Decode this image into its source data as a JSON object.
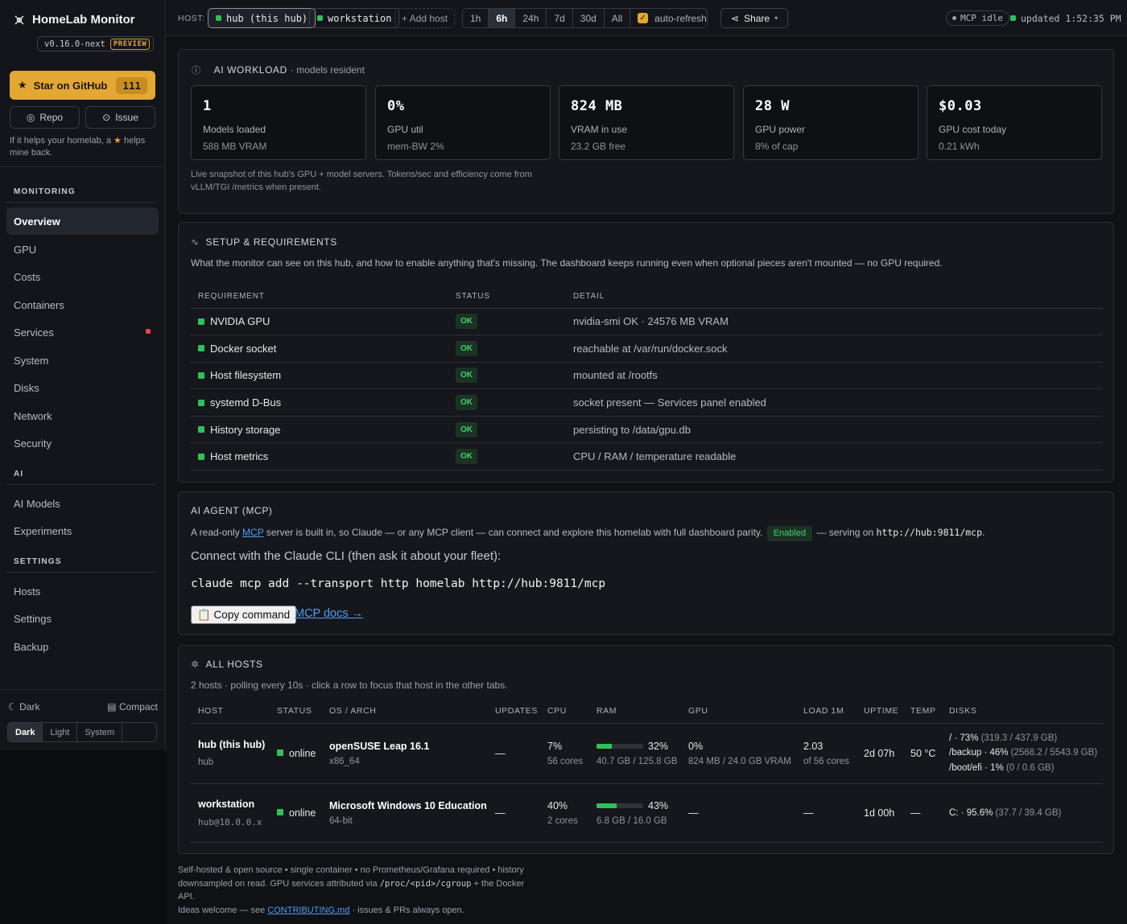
{
  "sidebar": {
    "app_title": "HomeLab Monitor",
    "version": "v0.16.0-next",
    "preview_badge": "PREVIEW",
    "star_label": "Star on GitHub",
    "star_count": "111",
    "repo_label": "Repo",
    "issue_label": "Issue",
    "help_text_1": "If it helps your homelab, a",
    "help_text_2": "helps mine back.",
    "sections": {
      "monitoring": "MONITORING",
      "ai": "AI",
      "settings": "SETTINGS"
    },
    "items": {
      "overview": "Overview",
      "gpu": "GPU",
      "costs": "Costs",
      "containers": "Containers",
      "services": "Services",
      "system": "System",
      "disks": "Disks",
      "network": "Network",
      "security": "Security",
      "ai_models": "AI Models",
      "experiments": "Experiments",
      "hosts": "Hosts",
      "settings": "Settings",
      "backup": "Backup"
    },
    "theme_label": "Dark",
    "compact_label": "Compact",
    "theme_options": [
      "Dark",
      "Light",
      "System"
    ]
  },
  "topbar": {
    "host_label": "HOST:",
    "hosts": [
      "hub (this hub)",
      "workstation"
    ],
    "add_host": "+ Add host",
    "ranges": [
      "1h",
      "6h",
      "24h",
      "7d",
      "30d",
      "All"
    ],
    "selected_range": "6h",
    "auto_refresh": "auto-refresh",
    "share": "Share",
    "mcp_status": "MCP idle",
    "updated": "updated 1:52:35 PM"
  },
  "ai_workload": {
    "title": "AI WORKLOAD",
    "subtitle": "· models resident",
    "stats": [
      {
        "value": "1",
        "label": "Models loaded",
        "sub": "588 MB VRAM"
      },
      {
        "value": "0%",
        "label": "GPU util",
        "sub": "mem-BW 2%"
      },
      {
        "value": "824 MB",
        "label": "VRAM in use",
        "sub": "23.2 GB free"
      },
      {
        "value": "28 W",
        "label": "GPU power",
        "sub": "8% of cap"
      },
      {
        "value": "$0.03",
        "label": "GPU cost today",
        "sub": "0.21 kWh"
      }
    ],
    "note": "Live snapshot of this hub's GPU + model servers. Tokens/sec and efficiency come from vLLM/TGI /metrics when present."
  },
  "setup": {
    "title": "SETUP & REQUIREMENTS",
    "description": "What the monitor can see on this hub, and how to enable anything that's missing. The dashboard keeps running even when optional pieces aren't mounted — no GPU required.",
    "columns": [
      "REQUIREMENT",
      "STATUS",
      "DETAIL"
    ],
    "rows": [
      {
        "name": "NVIDIA GPU",
        "status": "OK",
        "detail": "nvidia-smi OK · 24576 MB VRAM"
      },
      {
        "name": "Docker socket",
        "status": "OK",
        "detail": "reachable at /var/run/docker.sock"
      },
      {
        "name": "Host filesystem",
        "status": "OK",
        "detail": "mounted at /rootfs"
      },
      {
        "name": "systemd D-Bus",
        "status": "OK",
        "detail": "socket present — Services panel enabled"
      },
      {
        "name": "History storage",
        "status": "OK",
        "detail": "persisting to /data/gpu.db"
      },
      {
        "name": "Host metrics",
        "status": "OK",
        "detail": "CPU / RAM / temperature readable"
      }
    ]
  },
  "mcp": {
    "title": "AI AGENT (MCP)",
    "desc_1": "A read-only",
    "desc_link": "MCP",
    "desc_2": "server is built in, so Claude — or any MCP client — can connect and explore this homelab with full dashboard parity.",
    "enabled_badge": "Enabled",
    "desc_3": "— serving on",
    "endpoint": "http://hub:9811/mcp",
    "desc_4": ".",
    "connect_text": "Connect with the Claude CLI (then ask it about your fleet):",
    "command": "claude mcp add --transport http homelab http://hub:9811/mcp",
    "copy_button": "📋 Copy command",
    "docs_link": "MCP docs →"
  },
  "all_hosts": {
    "title": "ALL HOSTS",
    "description": "2 hosts · polling every 10s · click a row to focus that host in the other tabs.",
    "columns": [
      "HOST",
      "STATUS",
      "OS / ARCH",
      "UPDATES",
      "CPU",
      "RAM",
      "GPU",
      "LOAD 1M",
      "UPTIME",
      "TEMP",
      "DISKS"
    ],
    "rows": [
      {
        "host": "hub (this hub)",
        "host_sub": "hub",
        "status": "online",
        "os": "openSUSE Leap 16.1",
        "arch": "x86_64",
        "updates": "—",
        "cpu": "7%",
        "cpu_sub": "56 cores",
        "ram_pct": "32%",
        "ram_fill": 32,
        "ram_sub": "40.7 GB / 125.8 GB",
        "gpu": "0%",
        "gpu_sub": "824 MB / 24.0 GB VRAM",
        "load": "2.03",
        "load_sub": "of 56 cores",
        "uptime": "2d 07h",
        "temp": "50 °C",
        "disks": [
          {
            "mount": "/ · 73%",
            "detail": "(319.3 / 437.9 GB)"
          },
          {
            "mount": "/backup · 46%",
            "detail": "(2568.2 / 5543.9 GB)"
          },
          {
            "mount": "/boot/efi · 1%",
            "detail": "(0 / 0.6 GB)"
          }
        ]
      },
      {
        "host": "workstation",
        "host_sub": "hub@10.0.0.x",
        "status": "online",
        "os": "Microsoft Windows 10 Education",
        "arch": "64-bit",
        "updates": "—",
        "cpu": "40%",
        "cpu_sub": "2 cores",
        "ram_pct": "43%",
        "ram_fill": 43,
        "ram_sub": "6.8 GB / 16.0 GB",
        "gpu": "—",
        "gpu_sub": "",
        "load": "—",
        "load_sub": "",
        "uptime": "1d 00h",
        "temp": "—",
        "disks": [
          {
            "mount": "C: · 95.6%",
            "detail": "(37.7 / 39.4 GB)"
          }
        ]
      }
    ]
  },
  "footer": {
    "line_1": "Self-hosted & open source • single container • no Prometheus/Grafana required • history downsampled on read. GPU services attributed via",
    "code": "/proc/<pid>/cgroup",
    "line_2": "+ the Docker API.",
    "line_3": "Ideas welcome — see",
    "link": "CONTRIBUTING.md",
    "line_4": "· issues & PRs always open."
  },
  "colors": {
    "accent": "#e3a733",
    "ok": "#30c05a",
    "alert": "#e5484d",
    "link": "#4e9ef5"
  }
}
